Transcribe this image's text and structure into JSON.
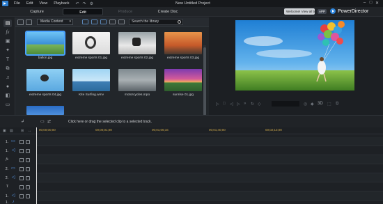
{
  "menu": {
    "items": [
      "File",
      "Edit",
      "View",
      "Playback"
    ],
    "project_title": "New Untitled Project"
  },
  "modes": {
    "capture": "Capture",
    "edit": "Edit",
    "produce": "Produce",
    "create_disc": "Create Disc"
  },
  "header": {
    "welcome": "Welcome! View all tutorial videos here!",
    "app_badge": "APP",
    "brand": "PowerDirector"
  },
  "library": {
    "filter": "Media Content",
    "search_placeholder": "Search the library",
    "items": [
      {
        "label": "ballon.jpg"
      },
      {
        "label": "extreme sports 01.jpg"
      },
      {
        "label": "extreme sports 02.jpg"
      },
      {
        "label": "extreme sports 03.jpg"
      },
      {
        "label": "extreme sports 04.jpg"
      },
      {
        "label": "Kite Surfing.wmv"
      },
      {
        "label": "motorcycles.mpo"
      },
      {
        "label": "sunrise 01.jpg"
      }
    ]
  },
  "timeline": {
    "drag_tip": "Click here or drag the selected clip to a selected track.",
    "ruler_labels": [
      "00;00;00;00",
      "00;00;01;08",
      "00;01;06;16",
      "00;01;40;00",
      "00;02;13;08"
    ],
    "tracks": [
      "1.",
      "1.",
      "fx",
      "2.",
      "2.",
      "T",
      "1.",
      "1."
    ]
  },
  "colors": {
    "accent": "#4aa3ff",
    "timecode": "#c8a44a"
  }
}
